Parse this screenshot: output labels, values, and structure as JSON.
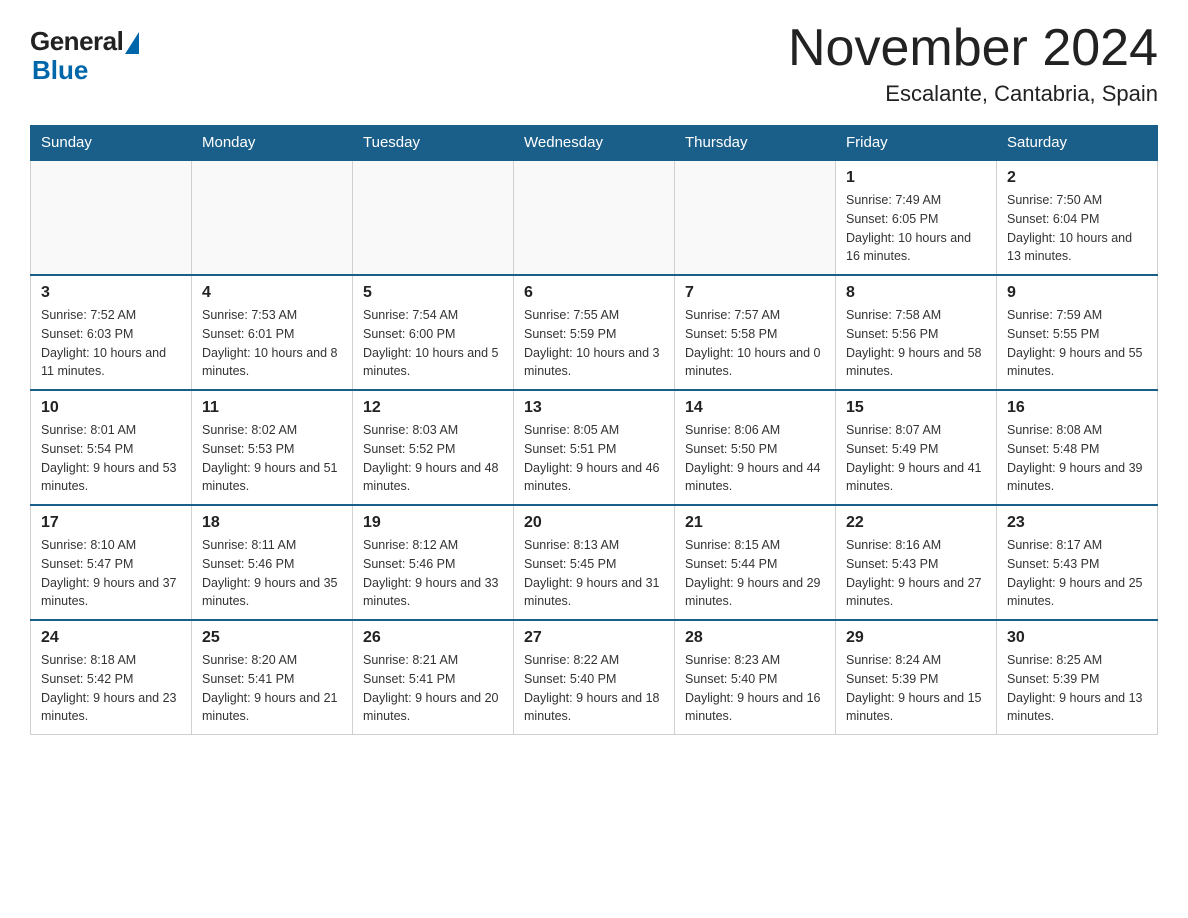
{
  "header": {
    "logo": {
      "general": "General",
      "blue": "Blue"
    },
    "title": "November 2024",
    "subtitle": "Escalante, Cantabria, Spain"
  },
  "calendar": {
    "days_of_week": [
      "Sunday",
      "Monday",
      "Tuesday",
      "Wednesday",
      "Thursday",
      "Friday",
      "Saturday"
    ],
    "weeks": [
      [
        {
          "day": "",
          "info": ""
        },
        {
          "day": "",
          "info": ""
        },
        {
          "day": "",
          "info": ""
        },
        {
          "day": "",
          "info": ""
        },
        {
          "day": "",
          "info": ""
        },
        {
          "day": "1",
          "info": "Sunrise: 7:49 AM\nSunset: 6:05 PM\nDaylight: 10 hours and 16 minutes."
        },
        {
          "day": "2",
          "info": "Sunrise: 7:50 AM\nSunset: 6:04 PM\nDaylight: 10 hours and 13 minutes."
        }
      ],
      [
        {
          "day": "3",
          "info": "Sunrise: 7:52 AM\nSunset: 6:03 PM\nDaylight: 10 hours and 11 minutes."
        },
        {
          "day": "4",
          "info": "Sunrise: 7:53 AM\nSunset: 6:01 PM\nDaylight: 10 hours and 8 minutes."
        },
        {
          "day": "5",
          "info": "Sunrise: 7:54 AM\nSunset: 6:00 PM\nDaylight: 10 hours and 5 minutes."
        },
        {
          "day": "6",
          "info": "Sunrise: 7:55 AM\nSunset: 5:59 PM\nDaylight: 10 hours and 3 minutes."
        },
        {
          "day": "7",
          "info": "Sunrise: 7:57 AM\nSunset: 5:58 PM\nDaylight: 10 hours and 0 minutes."
        },
        {
          "day": "8",
          "info": "Sunrise: 7:58 AM\nSunset: 5:56 PM\nDaylight: 9 hours and 58 minutes."
        },
        {
          "day": "9",
          "info": "Sunrise: 7:59 AM\nSunset: 5:55 PM\nDaylight: 9 hours and 55 minutes."
        }
      ],
      [
        {
          "day": "10",
          "info": "Sunrise: 8:01 AM\nSunset: 5:54 PM\nDaylight: 9 hours and 53 minutes."
        },
        {
          "day": "11",
          "info": "Sunrise: 8:02 AM\nSunset: 5:53 PM\nDaylight: 9 hours and 51 minutes."
        },
        {
          "day": "12",
          "info": "Sunrise: 8:03 AM\nSunset: 5:52 PM\nDaylight: 9 hours and 48 minutes."
        },
        {
          "day": "13",
          "info": "Sunrise: 8:05 AM\nSunset: 5:51 PM\nDaylight: 9 hours and 46 minutes."
        },
        {
          "day": "14",
          "info": "Sunrise: 8:06 AM\nSunset: 5:50 PM\nDaylight: 9 hours and 44 minutes."
        },
        {
          "day": "15",
          "info": "Sunrise: 8:07 AM\nSunset: 5:49 PM\nDaylight: 9 hours and 41 minutes."
        },
        {
          "day": "16",
          "info": "Sunrise: 8:08 AM\nSunset: 5:48 PM\nDaylight: 9 hours and 39 minutes."
        }
      ],
      [
        {
          "day": "17",
          "info": "Sunrise: 8:10 AM\nSunset: 5:47 PM\nDaylight: 9 hours and 37 minutes."
        },
        {
          "day": "18",
          "info": "Sunrise: 8:11 AM\nSunset: 5:46 PM\nDaylight: 9 hours and 35 minutes."
        },
        {
          "day": "19",
          "info": "Sunrise: 8:12 AM\nSunset: 5:46 PM\nDaylight: 9 hours and 33 minutes."
        },
        {
          "day": "20",
          "info": "Sunrise: 8:13 AM\nSunset: 5:45 PM\nDaylight: 9 hours and 31 minutes."
        },
        {
          "day": "21",
          "info": "Sunrise: 8:15 AM\nSunset: 5:44 PM\nDaylight: 9 hours and 29 minutes."
        },
        {
          "day": "22",
          "info": "Sunrise: 8:16 AM\nSunset: 5:43 PM\nDaylight: 9 hours and 27 minutes."
        },
        {
          "day": "23",
          "info": "Sunrise: 8:17 AM\nSunset: 5:43 PM\nDaylight: 9 hours and 25 minutes."
        }
      ],
      [
        {
          "day": "24",
          "info": "Sunrise: 8:18 AM\nSunset: 5:42 PM\nDaylight: 9 hours and 23 minutes."
        },
        {
          "day": "25",
          "info": "Sunrise: 8:20 AM\nSunset: 5:41 PM\nDaylight: 9 hours and 21 minutes."
        },
        {
          "day": "26",
          "info": "Sunrise: 8:21 AM\nSunset: 5:41 PM\nDaylight: 9 hours and 20 minutes."
        },
        {
          "day": "27",
          "info": "Sunrise: 8:22 AM\nSunset: 5:40 PM\nDaylight: 9 hours and 18 minutes."
        },
        {
          "day": "28",
          "info": "Sunrise: 8:23 AM\nSunset: 5:40 PM\nDaylight: 9 hours and 16 minutes."
        },
        {
          "day": "29",
          "info": "Sunrise: 8:24 AM\nSunset: 5:39 PM\nDaylight: 9 hours and 15 minutes."
        },
        {
          "day": "30",
          "info": "Sunrise: 8:25 AM\nSunset: 5:39 PM\nDaylight: 9 hours and 13 minutes."
        }
      ]
    ]
  }
}
